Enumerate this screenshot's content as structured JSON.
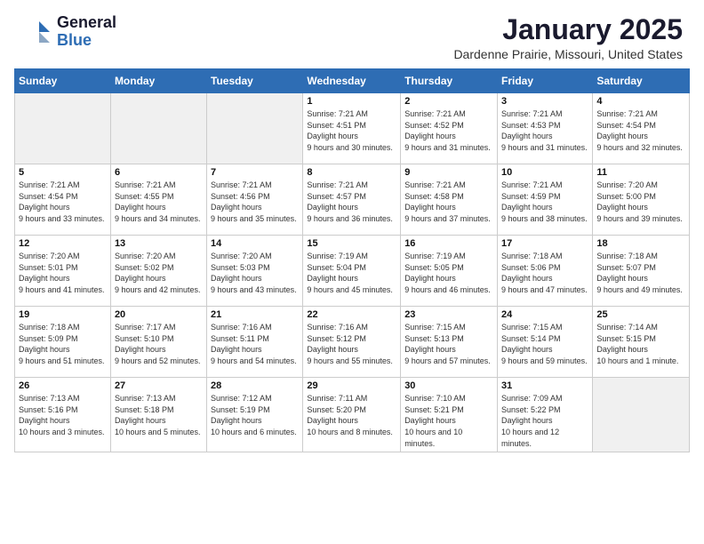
{
  "header": {
    "logo_general": "General",
    "logo_blue": "Blue",
    "month_year": "January 2025",
    "location": "Dardenne Prairie, Missouri, United States"
  },
  "weekdays": [
    "Sunday",
    "Monday",
    "Tuesday",
    "Wednesday",
    "Thursday",
    "Friday",
    "Saturday"
  ],
  "weeks": [
    [
      {
        "day": "",
        "empty": true
      },
      {
        "day": "",
        "empty": true
      },
      {
        "day": "",
        "empty": true
      },
      {
        "day": "1",
        "sunrise": "7:21 AM",
        "sunset": "4:51 PM",
        "daylight": "9 hours and 30 minutes."
      },
      {
        "day": "2",
        "sunrise": "7:21 AM",
        "sunset": "4:52 PM",
        "daylight": "9 hours and 31 minutes."
      },
      {
        "day": "3",
        "sunrise": "7:21 AM",
        "sunset": "4:53 PM",
        "daylight": "9 hours and 31 minutes."
      },
      {
        "day": "4",
        "sunrise": "7:21 AM",
        "sunset": "4:54 PM",
        "daylight": "9 hours and 32 minutes."
      }
    ],
    [
      {
        "day": "5",
        "sunrise": "7:21 AM",
        "sunset": "4:54 PM",
        "daylight": "9 hours and 33 minutes."
      },
      {
        "day": "6",
        "sunrise": "7:21 AM",
        "sunset": "4:55 PM",
        "daylight": "9 hours and 34 minutes."
      },
      {
        "day": "7",
        "sunrise": "7:21 AM",
        "sunset": "4:56 PM",
        "daylight": "9 hours and 35 minutes."
      },
      {
        "day": "8",
        "sunrise": "7:21 AM",
        "sunset": "4:57 PM",
        "daylight": "9 hours and 36 minutes."
      },
      {
        "day": "9",
        "sunrise": "7:21 AM",
        "sunset": "4:58 PM",
        "daylight": "9 hours and 37 minutes."
      },
      {
        "day": "10",
        "sunrise": "7:21 AM",
        "sunset": "4:59 PM",
        "daylight": "9 hours and 38 minutes."
      },
      {
        "day": "11",
        "sunrise": "7:20 AM",
        "sunset": "5:00 PM",
        "daylight": "9 hours and 39 minutes."
      }
    ],
    [
      {
        "day": "12",
        "sunrise": "7:20 AM",
        "sunset": "5:01 PM",
        "daylight": "9 hours and 41 minutes."
      },
      {
        "day": "13",
        "sunrise": "7:20 AM",
        "sunset": "5:02 PM",
        "daylight": "9 hours and 42 minutes."
      },
      {
        "day": "14",
        "sunrise": "7:20 AM",
        "sunset": "5:03 PM",
        "daylight": "9 hours and 43 minutes."
      },
      {
        "day": "15",
        "sunrise": "7:19 AM",
        "sunset": "5:04 PM",
        "daylight": "9 hours and 45 minutes."
      },
      {
        "day": "16",
        "sunrise": "7:19 AM",
        "sunset": "5:05 PM",
        "daylight": "9 hours and 46 minutes."
      },
      {
        "day": "17",
        "sunrise": "7:18 AM",
        "sunset": "5:06 PM",
        "daylight": "9 hours and 47 minutes."
      },
      {
        "day": "18",
        "sunrise": "7:18 AM",
        "sunset": "5:07 PM",
        "daylight": "9 hours and 49 minutes."
      }
    ],
    [
      {
        "day": "19",
        "sunrise": "7:18 AM",
        "sunset": "5:09 PM",
        "daylight": "9 hours and 51 minutes."
      },
      {
        "day": "20",
        "sunrise": "7:17 AM",
        "sunset": "5:10 PM",
        "daylight": "9 hours and 52 minutes."
      },
      {
        "day": "21",
        "sunrise": "7:16 AM",
        "sunset": "5:11 PM",
        "daylight": "9 hours and 54 minutes."
      },
      {
        "day": "22",
        "sunrise": "7:16 AM",
        "sunset": "5:12 PM",
        "daylight": "9 hours and 55 minutes."
      },
      {
        "day": "23",
        "sunrise": "7:15 AM",
        "sunset": "5:13 PM",
        "daylight": "9 hours and 57 minutes."
      },
      {
        "day": "24",
        "sunrise": "7:15 AM",
        "sunset": "5:14 PM",
        "daylight": "9 hours and 59 minutes."
      },
      {
        "day": "25",
        "sunrise": "7:14 AM",
        "sunset": "5:15 PM",
        "daylight": "10 hours and 1 minute."
      }
    ],
    [
      {
        "day": "26",
        "sunrise": "7:13 AM",
        "sunset": "5:16 PM",
        "daylight": "10 hours and 3 minutes."
      },
      {
        "day": "27",
        "sunrise": "7:13 AM",
        "sunset": "5:18 PM",
        "daylight": "10 hours and 5 minutes."
      },
      {
        "day": "28",
        "sunrise": "7:12 AM",
        "sunset": "5:19 PM",
        "daylight": "10 hours and 6 minutes."
      },
      {
        "day": "29",
        "sunrise": "7:11 AM",
        "sunset": "5:20 PM",
        "daylight": "10 hours and 8 minutes."
      },
      {
        "day": "30",
        "sunrise": "7:10 AM",
        "sunset": "5:21 PM",
        "daylight": "10 hours and 10 minutes."
      },
      {
        "day": "31",
        "sunrise": "7:09 AM",
        "sunset": "5:22 PM",
        "daylight": "10 hours and 12 minutes."
      },
      {
        "day": "",
        "empty": true
      }
    ]
  ]
}
